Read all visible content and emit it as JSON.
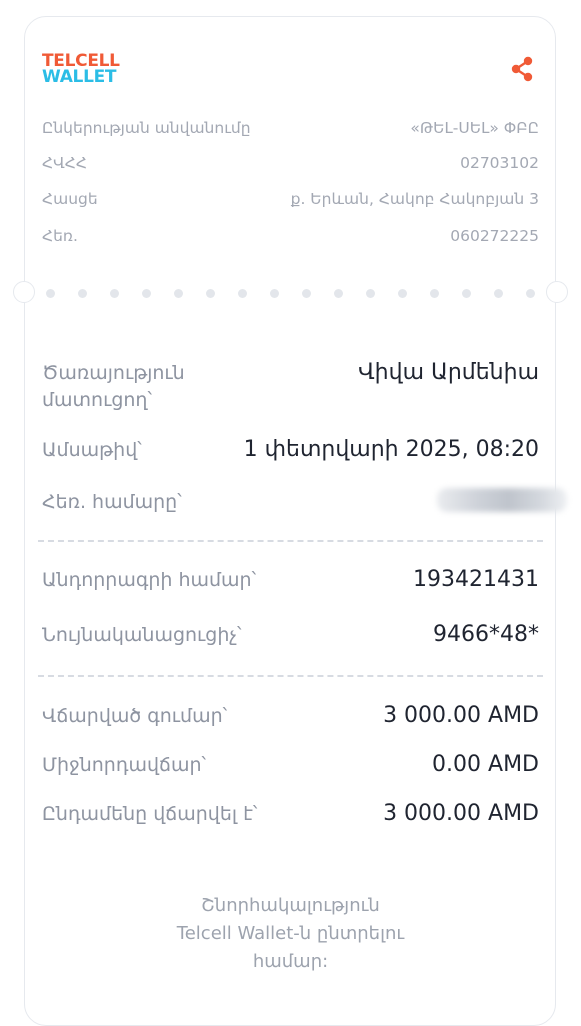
{
  "brand": {
    "line1": "TELCELL",
    "line2": "WALLET"
  },
  "share_icon": "share-icon",
  "colors": {
    "brand_orange": "#f05a36",
    "brand_blue": "#2bbde6",
    "text_dark": "#1f2430",
    "text_muted": "#8e94a1"
  },
  "company": {
    "name_label": "Ընկերության անվանումը",
    "name_value": "«ԹԵԼ-ՍԵԼ» ՓԲԸ",
    "tin_label": "ՀՎՀՀ",
    "tin_value": "02703102",
    "address_label": "Հասցե",
    "address_value": "ք. Երևան, Հակոբ Հակոբյան 3",
    "phone_label": "Հեռ.",
    "phone_value": "060272225"
  },
  "payment": {
    "provider_label_1": "Ծառայություն",
    "provider_label_2": "մատուցող՝",
    "provider_value": "Վիվա Արմենիա",
    "date_label": "Ամսաթիվ՝",
    "date_value": "1 փետրվարի 2025, 08:20",
    "phone_label": "Հեռ. համարը՝",
    "receipt_label": "Անդորրագրի համար՝",
    "receipt_value": "193421431",
    "id_label": "Նույնականացուցիչ՝",
    "id_value": "9466*48*",
    "paid_label": "Վճարված գումար՝",
    "paid_value": "3 000.00 AMD",
    "fee_label": "Միջնորդավճար՝",
    "fee_value": "0.00 AMD",
    "total_label": "Ընդամենը վճարվել է՝",
    "total_value": "3 000.00 AMD"
  },
  "thanks": {
    "line1": "Շնորհակալություն",
    "line2": "Telcell Wallet-ն ընտրելու",
    "line3": "համար:"
  }
}
